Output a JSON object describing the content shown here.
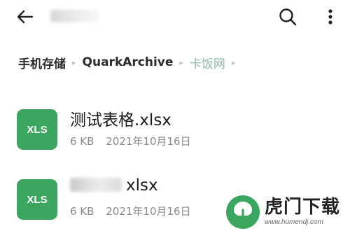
{
  "header": {
    "back_icon": "arrow-left-icon",
    "search_icon": "search-icon",
    "more_icon": "more-vertical-icon"
  },
  "breadcrumb": {
    "items": [
      "手机存储",
      "QuarkArchive",
      "卡饭网"
    ],
    "separator": "▸"
  },
  "files": [
    {
      "icon_label": "XLS",
      "name": "测试表格.xlsx",
      "size": "6 KB",
      "date": "2021年10月16日"
    },
    {
      "icon_label": "XLS",
      "name_visible_suffix": "xlsx",
      "size": "6 KB",
      "date": "2021年10月16日"
    }
  ],
  "watermark": {
    "name": "虎门下载",
    "url": "www.humendj.com"
  },
  "colors": {
    "xls_icon": "#3aa65f",
    "breadcrumb_current": "#8fb8a6",
    "watermark_logo": "#3aa65f"
  }
}
